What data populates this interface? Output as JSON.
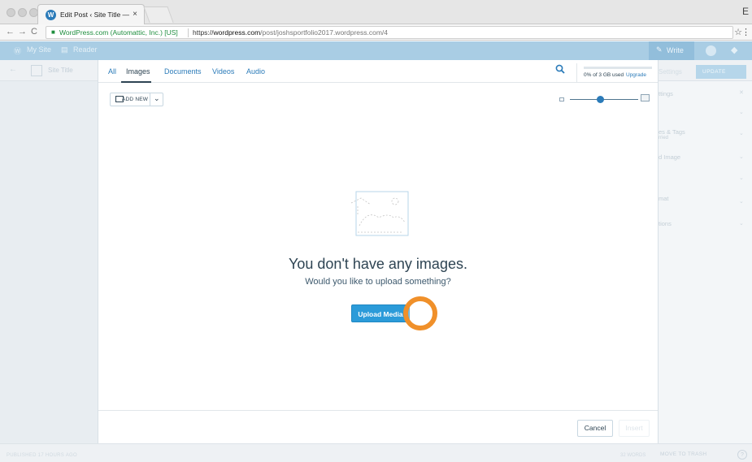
{
  "browser": {
    "tab_title": "Edit Post ‹ Site Title — WordPress",
    "tab_close": "×",
    "profile_initial": "E",
    "secure_label": "WordPress.com (Automattic, Inc.) [US]",
    "url_scheme": "https://",
    "url_host": "wordpress.com",
    "url_path": "/post/joshsportfolio2017.wordpress.com/4"
  },
  "masterbar": {
    "my_site": "My Site",
    "reader": "Reader",
    "write": "Write"
  },
  "editor_background": {
    "site_title": "Site Title",
    "settings": "Settings",
    "update": "UPDATE",
    "sidebar_items": [
      "ttings",
      "es & Tags",
      "d Image",
      "mat",
      "tions"
    ],
    "sidebar_sub": "rried",
    "published": "PUBLISHED 17 HOURS AGO",
    "words": "32 WORDS",
    "move_to_trash": "MOVE TO TRASH",
    "help": "?"
  },
  "media_modal": {
    "tabs": [
      {
        "label": "All",
        "active": false
      },
      {
        "label": "Images",
        "active": true
      },
      {
        "label": "Documents",
        "active": false
      },
      {
        "label": "Videos",
        "active": false
      },
      {
        "label": "Audio",
        "active": false
      }
    ],
    "storage_used": "0% of 3 GB used",
    "storage_upgrade": "Upgrade",
    "storage_fraction": 0.0,
    "add_new": "ADD NEW",
    "zoom_level_fraction": 0.42,
    "empty_title": "You don't have any images.",
    "empty_subtitle": "Would you like to upload something?",
    "upload_button": "Upload Media",
    "cancel_button": "Cancel",
    "insert_button": "Insert"
  },
  "colors": {
    "accent_blue": "#2b7bb9",
    "upload_blue": "#2b9bd9",
    "text_dark": "#2e4453",
    "click_marker": "#f0902a"
  }
}
